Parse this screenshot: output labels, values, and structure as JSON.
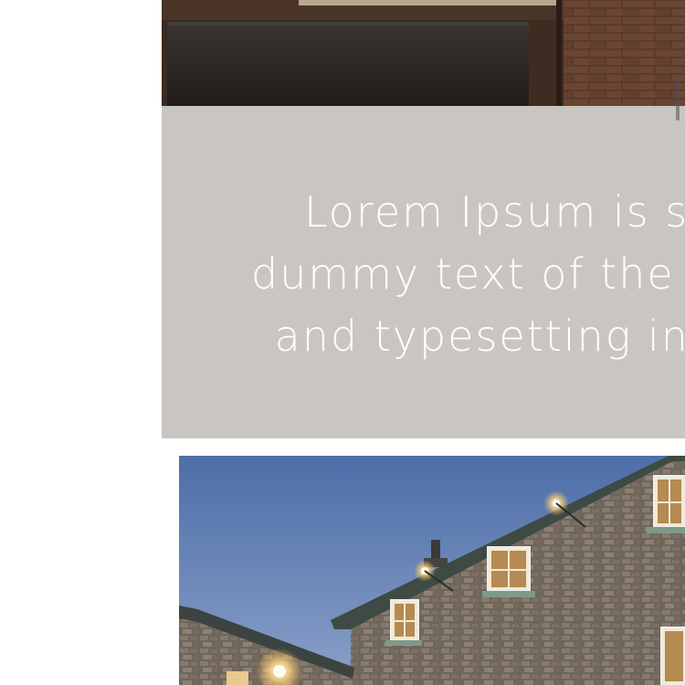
{
  "content": {
    "lines": [
      "Lorem Ipsum is simply",
      "dummy text of the printing",
      "and typesetting industry."
    ]
  },
  "images": {
    "top_image": "interior-window-photo",
    "bottom_image": "stone-building-at-dusk-photo"
  },
  "colors": {
    "panel_background": "#c9c6c2",
    "panel_text": "#ffffff",
    "sky": "#5b79b0",
    "stone": "#7a6e63"
  }
}
